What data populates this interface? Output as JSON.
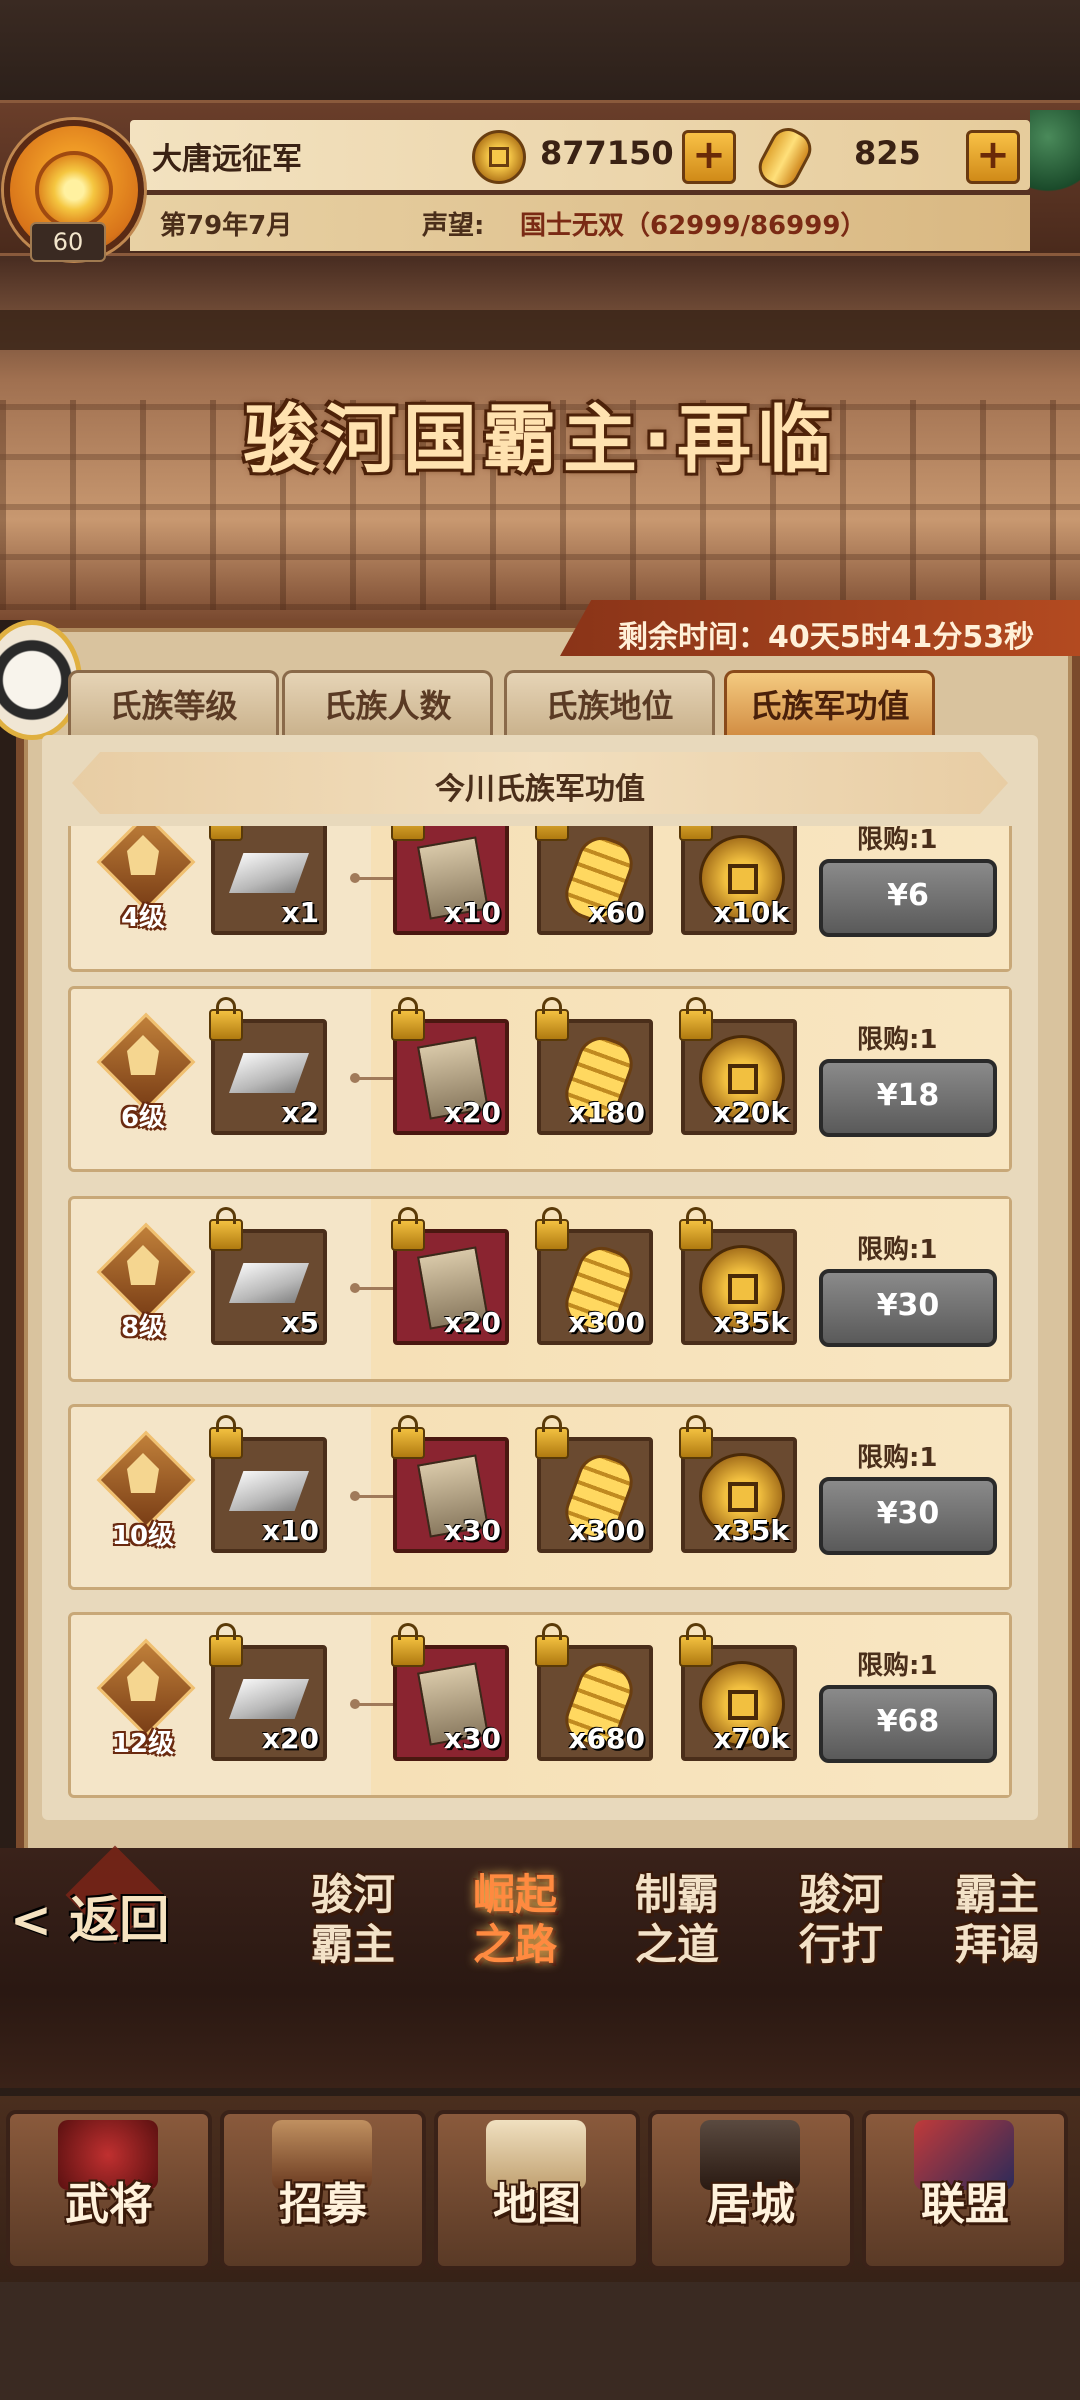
{
  "header": {
    "clan_name": "大唐远征军",
    "level": "60",
    "date": "第79年7月",
    "reputation_label": "声望:",
    "reputation_value": "国士无双（62999/86999）",
    "coins": "877150",
    "ingots": "825",
    "plus_symbol": "+"
  },
  "event": {
    "title": "骏河国霸主·再临",
    "timer": "剩余时间：40天5时41分53秒"
  },
  "tabs": [
    {
      "label": "氏族等级",
      "active": false
    },
    {
      "label": "氏族人数",
      "active": false
    },
    {
      "label": "氏族地位",
      "active": false
    },
    {
      "label": "氏族军功值",
      "active": true
    }
  ],
  "section_title": "今川氏族军功值",
  "rows": [
    {
      "rank": "4级",
      "silver": "x1",
      "scroll": "x10",
      "gold": "x60",
      "coin": "x10k",
      "limit": "限购:1",
      "price": "¥6"
    },
    {
      "rank": "6级",
      "silver": "x2",
      "scroll": "x20",
      "gold": "x180",
      "coin": "x20k",
      "limit": "限购:1",
      "price": "¥18"
    },
    {
      "rank": "8级",
      "silver": "x5",
      "scroll": "x20",
      "gold": "x300",
      "coin": "x35k",
      "limit": "限购:1",
      "price": "¥30"
    },
    {
      "rank": "10级",
      "silver": "x10",
      "scroll": "x30",
      "gold": "x300",
      "coin": "x35k",
      "limit": "限购:1",
      "price": "¥30"
    },
    {
      "rank": "12级",
      "silver": "x20",
      "scroll": "x30",
      "gold": "x680",
      "coin": "x70k",
      "limit": "限购:1",
      "price": "¥68"
    }
  ],
  "subnav": {
    "back": "< 返回",
    "items": [
      {
        "label": "骏河\n霸主",
        "active": false
      },
      {
        "label": "崛起\n之路",
        "active": true
      },
      {
        "label": "制霸\n之道",
        "active": false
      },
      {
        "label": "骏河\n行打",
        "active": false
      },
      {
        "label": "霸主\n拜谒",
        "active": false
      }
    ]
  },
  "bottom_nav": [
    {
      "label": "武将",
      "icon": "samurai-helmet-icon"
    },
    {
      "label": "招募",
      "icon": "sword-rack-icon"
    },
    {
      "label": "地图",
      "icon": "scroll-map-icon"
    },
    {
      "label": "居城",
      "icon": "castle-icon"
    },
    {
      "label": "联盟",
      "icon": "alliance-fans-icon"
    }
  ]
}
